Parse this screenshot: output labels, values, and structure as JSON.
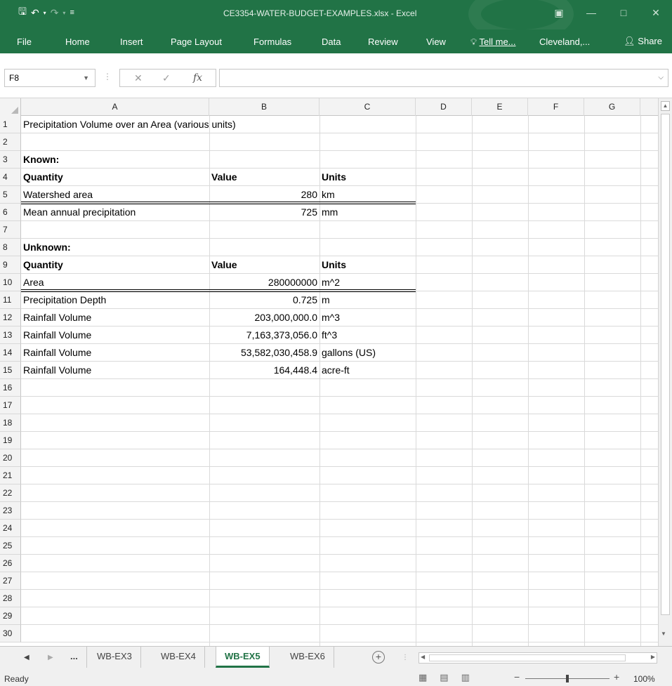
{
  "window": {
    "title": "CE3354-WATER-BUDGET-EXAMPLES.xlsx - Excel",
    "accent": "#217346"
  },
  "quick_access": {
    "save_icon": "save-icon",
    "undo_icon": "undo-icon",
    "redo_icon": "redo-icon"
  },
  "ribbon": {
    "tabs": [
      "File",
      "Home",
      "Insert",
      "Page Layout",
      "Formulas",
      "Data",
      "Review",
      "View"
    ],
    "tell_me": "Tell me...",
    "user": "Cleveland,...",
    "share": "Share"
  },
  "formula_bar": {
    "name_box": "F8",
    "fx": "fx",
    "content": ""
  },
  "columns": [
    "A",
    "B",
    "C",
    "D",
    "E",
    "F",
    "G"
  ],
  "rows": [
    "1",
    "2",
    "3",
    "4",
    "5",
    "6",
    "7",
    "8",
    "9",
    "10",
    "11",
    "12",
    "13",
    "14",
    "15",
    "16",
    "17",
    "18",
    "19",
    "20",
    "21",
    "22",
    "23",
    "24",
    "25",
    "26",
    "27",
    "28",
    "29",
    "30"
  ],
  "sheet": {
    "r1a": "Precipitation Volume over an Area (various units)",
    "r3a": "Known:",
    "r4": {
      "a": "Quantity",
      "b": "Value",
      "c": "Units"
    },
    "r5": {
      "a": "Watershed area",
      "b": "280",
      "c": "km"
    },
    "r6": {
      "a": "Mean annual precipitation",
      "b": "725",
      "c": "mm"
    },
    "r8a": "Unknown:",
    "r9": {
      "a": "Quantity",
      "b": "Value",
      "c": "Units"
    },
    "r10": {
      "a": "Area",
      "b": "280000000",
      "c": "m^2"
    },
    "r11": {
      "a": "Precipitation Depth",
      "b": "0.725",
      "c": "m"
    },
    "r12": {
      "a": "Rainfall Volume",
      "b": "203,000,000.0",
      "c": "m^3"
    },
    "r13": {
      "a": "Rainfall Volume",
      "b": "7,163,373,056.0",
      "c": "ft^3"
    },
    "r14": {
      "a": "Rainfall Volume",
      "b": "53,582,030,458.9",
      "c": "gallons (US)"
    },
    "r15": {
      "a": "Rainfall Volume",
      "b": "164,448.4",
      "c": "acre-ft"
    }
  },
  "sheet_tabs": {
    "ellipsis": "...",
    "tabs": [
      "WB-EX3",
      "WB-EX4",
      "WB-EX5",
      "WB-EX6"
    ],
    "active": "WB-EX5"
  },
  "status": {
    "ready": "Ready",
    "zoom": "100%"
  }
}
